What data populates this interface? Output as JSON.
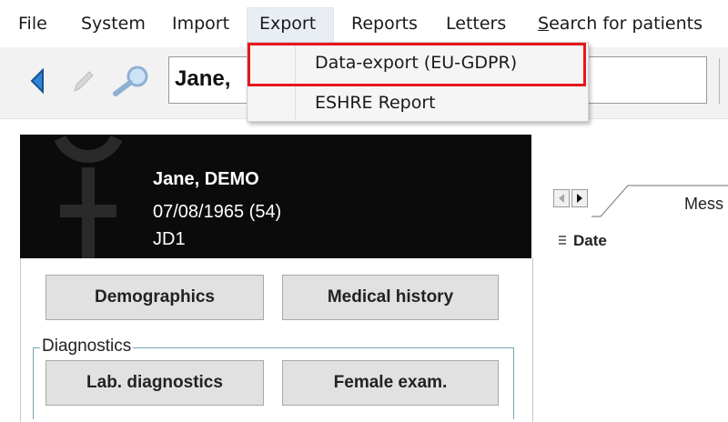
{
  "menubar": {
    "items": [
      "File",
      "System",
      "Import",
      "Export",
      "Reports",
      "Letters"
    ],
    "search_first": "S",
    "search_rest": "earch for patients"
  },
  "toolbar": {
    "search_value": "Jane,"
  },
  "export_menu": {
    "items": [
      "Data-export (EU-GDPR)",
      "ESHRE Report"
    ],
    "highlight_color": "#e8161d"
  },
  "patient": {
    "name": "Jane, DEMO",
    "dob_age": "07/08/1965  (54)",
    "id": "JD1"
  },
  "buttons": {
    "demographics": "Demographics",
    "medical_history": "Medical history",
    "lab_diagnostics": "Lab. diagnostics",
    "female_exam": "Female exam."
  },
  "diagnostics_group": {
    "label": "Diagnostics"
  },
  "right_pane": {
    "tab_label": "Mess",
    "column_date": "Date"
  },
  "icons": {
    "back": "left-arrow-icon",
    "edit": "pencil-icon",
    "search": "magnifier-icon",
    "logo": "female-symbol-icon"
  }
}
